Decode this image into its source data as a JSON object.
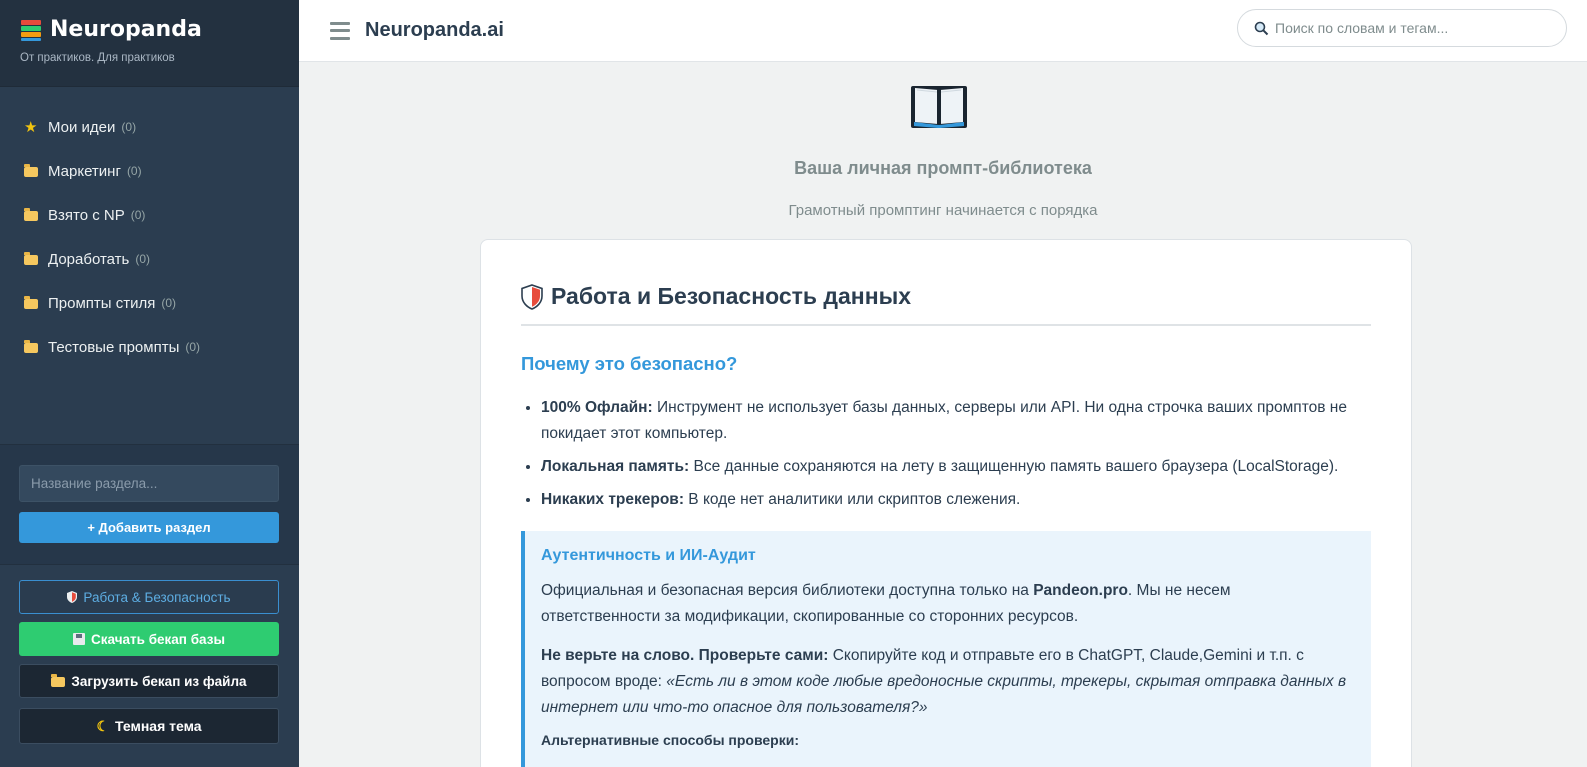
{
  "sidebar": {
    "brand": {
      "title": "Neuropanda",
      "subtitle": "От практиков. Для практиков"
    },
    "items": [
      {
        "label": "Мои идеи",
        "count": "(0)",
        "icon": "star-icon"
      },
      {
        "label": "Маркетинг",
        "count": "(0)",
        "icon": "folder-icon"
      },
      {
        "label": "Взято с NP",
        "count": "(0)",
        "icon": "folder-icon"
      },
      {
        "label": "Доработать",
        "count": "(0)",
        "icon": "folder-icon"
      },
      {
        "label": "Промпты стиля",
        "count": "(0)",
        "icon": "folder-icon"
      },
      {
        "label": "Тестовые промпты",
        "count": "(0)",
        "icon": "folder-icon"
      }
    ],
    "section_input_placeholder": "Название раздела...",
    "add_section_label": "+ Добавить раздел",
    "security_label": "Работа & Безопасность",
    "download_label": "Скачать бекап базы",
    "upload_label": "Загрузить бекап из файла",
    "theme_label": "Темная тема"
  },
  "header": {
    "title": "Neuropanda.ai",
    "search_placeholder": "Поиск по словам и тегам..."
  },
  "hero": {
    "title": "Ваша личная промпт-библиотека",
    "subtitle": "Грамотный промптинг начинается с порядка"
  },
  "card": {
    "title": "Работа и Безопасность данных",
    "section_title": "Почему это безопасно?",
    "bullets": [
      {
        "bold": "100% Офлайн:",
        "text": " Инструмент не использует базы данных, серверы или API. Ни одна строчка ваших промптов не покидает этот компьютер."
      },
      {
        "bold": "Локальная память:",
        "text": " Все данные сохраняются на лету в защищенную память вашего браузера (LocalStorage)."
      },
      {
        "bold": "Никаких трекеров:",
        "text": " В коде нет аналитики или скриптов слежения."
      }
    ],
    "callout": {
      "title": "Аутентичность и ИИ-Аудит",
      "p1_before": "Официальная и безопасная версия библиотеки доступна только на ",
      "p1_bold": "Pandeon.pro",
      "p1_after": ". Мы не несем ответственности за модификации, скопированные со сторонних ресурсов.",
      "p2_bold": "Не верьте на слово. Проверьте сами:",
      "p2_text": " Скопируйте код и отправьте его в ChatGPT, Claude,Gemini и т.п. с вопросом вроде: ",
      "p2_italic": "«Есть ли в этом коде любые вредоносные скрипты, трекеры, скрытая отправка данных в интернет или что-то опасное для пользователя?»",
      "alt_title": "Альтернативные способы проверки:"
    }
  },
  "colors": {
    "sidebar_bg": "#2b3d50",
    "accent": "#3498db",
    "success": "#2ecc71"
  }
}
